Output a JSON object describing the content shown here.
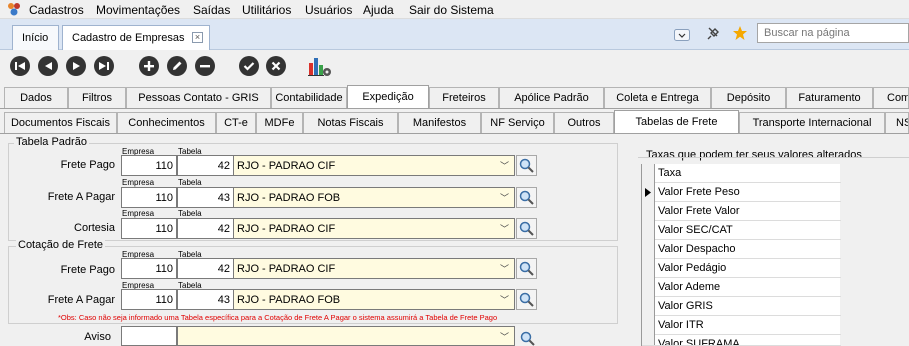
{
  "menu": [
    "Cadastros",
    "Movimentações",
    "Saídas",
    "Utilitários",
    "Usuários",
    "Ajuda",
    "Sair do Sistema"
  ],
  "doc_tabs": [
    {
      "label": "Início"
    },
    {
      "label": "Cadastro de Empresas"
    }
  ],
  "search": {
    "placeholder": "Buscar na página"
  },
  "toolbar_icons": [
    "first-record-icon",
    "previous-record-icon",
    "next-record-icon",
    "last-record-icon",
    "add-icon",
    "edit-icon",
    "remove-icon",
    "confirm-icon",
    "cancel-icon",
    "report-config-icon"
  ],
  "main_tabs": [
    "Dados",
    "Filtros",
    "Pessoas Contato - GRIS",
    "Contabilidade",
    "Expedição",
    "Freteiros",
    "Apólice Padrão",
    "Coleta e Entrega",
    "Depósito",
    "Faturamento",
    "Com"
  ],
  "main_tab_active": "Expedição",
  "sub_tabs": [
    "Documentos Fiscais",
    "Conhecimentos",
    "CT-e",
    "MDFe",
    "Notas Fiscais",
    "Manifestos",
    "NF Serviço",
    "Outros",
    "Tabelas de Frete",
    "Transporte Internacional",
    "NS"
  ],
  "sub_tab_active": "Tabelas de Frete",
  "tabela_padrao": {
    "title": "Tabela Padrão",
    "rows": [
      {
        "label": "Frete Pago",
        "empresa_cap": "Empresa",
        "tabela_cap": "Tabela",
        "empresa": "110",
        "tabela": "42",
        "descricao": "RJO - PADRAO CIF"
      },
      {
        "label": "Frete A Pagar",
        "empresa_cap": "Empresa",
        "tabela_cap": "Tabela",
        "empresa": "110",
        "tabela": "43",
        "descricao": "RJO - PADRAO FOB"
      },
      {
        "label": "Cortesia",
        "empresa_cap": "Empresa",
        "tabela_cap": "Tabela",
        "empresa": "110",
        "tabela": "42",
        "descricao": "RJO - PADRAO CIF"
      }
    ]
  },
  "cotacao": {
    "title": "Cotação de Frete",
    "rows": [
      {
        "label": "Frete Pago",
        "empresa_cap": "Empresa",
        "tabela_cap": "Tabela",
        "empresa": "110",
        "tabela": "42",
        "descricao": "RJO - PADRAO CIF"
      },
      {
        "label": "Frete A Pagar",
        "empresa_cap": "Empresa",
        "tabela_cap": "Tabela",
        "empresa": "110",
        "tabela": "43",
        "descricao": "RJO - PADRAO FOB"
      }
    ],
    "obs": "*Obs: Caso não seja informado uma Tabela específica para a Cotação de Frete A Pagar o sistema assumirá a Tabela de Frete Pago"
  },
  "aviso": {
    "label": "Aviso",
    "value": ""
  },
  "taxas": {
    "title": "Taxas que podem ter seus valores alterados",
    "header": "Taxa",
    "items": [
      "Valor Frete Peso",
      "Valor Frete Valor",
      "Valor SEC/CAT",
      "Valor Despacho",
      "Valor Pedágio",
      "Valor Ademe",
      "Valor GRIS",
      "Valor ITR",
      "Valor SUFRAMA"
    ],
    "current_index": 0
  },
  "colors": {
    "tab_strip": "#dce6f4",
    "combo_bg": "#fffbe0",
    "obs_red": "#e00000",
    "star": "#f5a800",
    "report_bars": [
      "#d9312b",
      "#2f6fb7",
      "#3aa14a"
    ]
  }
}
